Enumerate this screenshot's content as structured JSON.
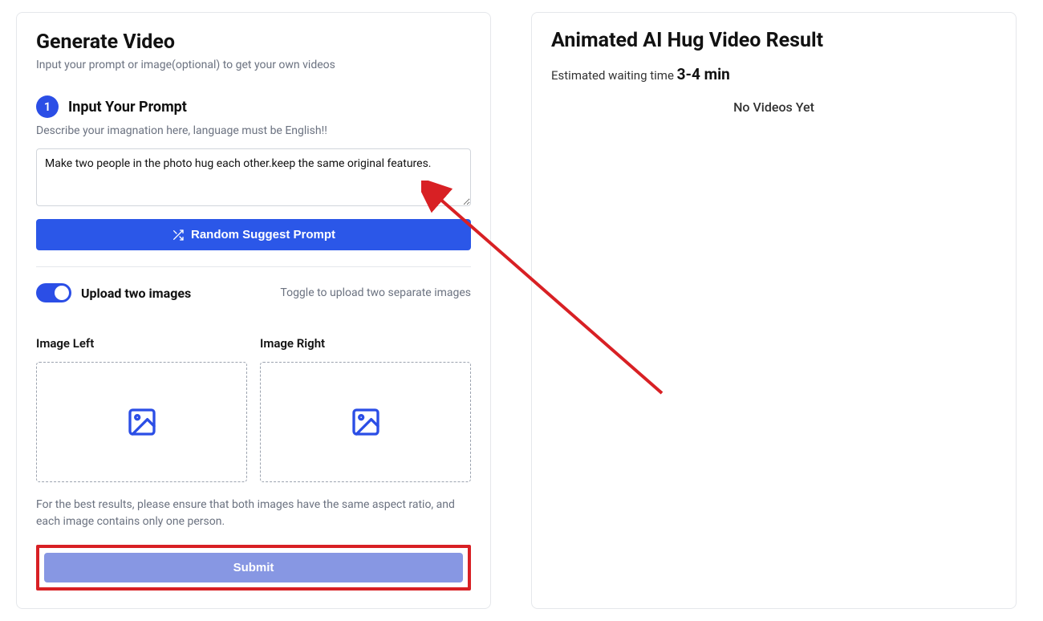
{
  "left": {
    "title": "Generate Video",
    "subtitle": "Input your prompt or image(optional) to get your own videos",
    "step1": {
      "num": "1",
      "label": "Input Your Prompt",
      "desc": "Describe your imagnation here, language must be English!!",
      "value": "Make two people in the photo hug each other.keep the same original features."
    },
    "random_label": "Random Suggest Prompt",
    "upload": {
      "label": "Upload two images",
      "help": "Toggle to upload two separate images",
      "left_label": "Image Left",
      "right_label": "Image Right",
      "note": "For the best results, please ensure that both images have the same aspect ratio, and each image contains only one person."
    },
    "submit_label": "Submit"
  },
  "right": {
    "title": "Animated AI Hug Video Result",
    "wait_prefix": "Estimated waiting time ",
    "wait_time": "3-4 min",
    "empty": "No Videos Yet"
  }
}
